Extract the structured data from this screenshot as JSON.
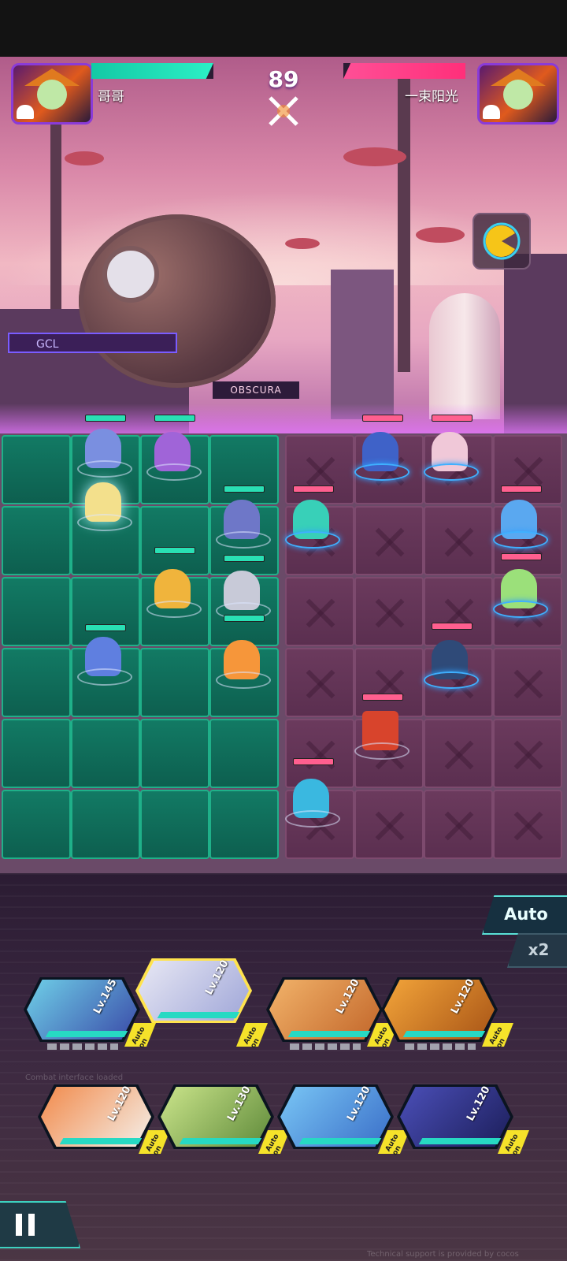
{
  "battle": {
    "timer": "89",
    "left_player": {
      "name": "哥哥"
    },
    "right_player": {
      "name": "一束阳光"
    }
  },
  "scene": {
    "sign_gcl": "GCL",
    "sign_obscura": "OBSCURA"
  },
  "controls": {
    "auto_label": "Auto",
    "speed_label": "x2"
  },
  "heroes_row1": [
    {
      "level": "Lv.145",
      "auto": "Auto on",
      "color": "#6fd0e8"
    },
    {
      "level": "Lv.120",
      "auto": "Auto on",
      "color": "#e8e8f4"
    },
    {
      "level": "Lv.120",
      "auto": "Auto on",
      "color": "#f2b36a"
    },
    {
      "level": "Lv.120",
      "auto": "Auto on",
      "color": "#f3a53a"
    }
  ],
  "heroes_row2": [
    {
      "level": "Lv.120",
      "auto": "Auto on",
      "color": "#f28a4b"
    },
    {
      "level": "Lv.130",
      "auto": "Auto on",
      "color": "#cbe58b"
    },
    {
      "level": "Lv.120",
      "auto": "Auto on",
      "color": "#79c6f5"
    },
    {
      "level": "Lv.120",
      "auto": "Auto on",
      "color": "#4b4fb8"
    }
  ],
  "combat_log": [
    "Combat interface loaded",
    "Technical support is provided by cocos"
  ],
  "colors": {
    "ally_tile": "#127a64",
    "enemy_tile": "#6b3a5d",
    "ally_hp": "#29e0b4",
    "enemy_hp": "#ff5f8f"
  }
}
